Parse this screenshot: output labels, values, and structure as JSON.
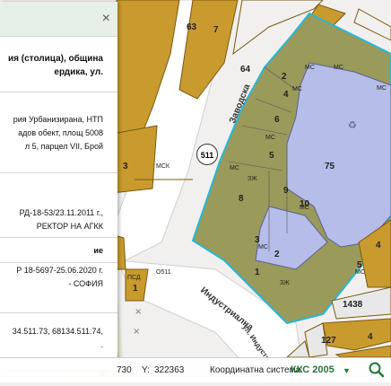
{
  "map": {
    "street_labels": [
      "Заводска",
      "Индустриална",
      "ул. Индустр"
    ],
    "parcel_numbers": [
      "63",
      "7",
      "64",
      "2",
      "3",
      "4",
      "6",
      "5",
      "75",
      "8",
      "9",
      "10",
      "3",
      "2",
      "4",
      "1",
      "5",
      "1438",
      "127",
      "4",
      "1",
      "1"
    ],
    "building_tags": [
      "МС",
      "МС",
      "МС",
      "МС",
      "МСК",
      "МС",
      "ЗЖ",
      "МС",
      "МС",
      "ЗЖ",
      "ПСД",
      "О511",
      "МС",
      "МС"
    ],
    "identifier_badge": "511",
    "colors": {
      "parcel_fill": "#c99a2e",
      "parcel_stroke": "#7a5a10",
      "selected_outline": "#29b6d6",
      "building_fill": "#b5bde8",
      "green_overlay": "#a0a060"
    }
  },
  "panel": {
    "close_label": "×",
    "title_lines": [
      "ия (столица), община",
      "ердика, ул."
    ],
    "body_lines": [
      "рия Урбанизирана, НТП",
      "адов обект, площ 5008",
      "л 5, парцел VII, Брой"
    ],
    "order_line": "РД-18-53/23.11.2011 г.,",
    "director_line": "РЕКТОР НА АГКК",
    "section_header": "ие",
    "order2_line": "Р 18-5697-25.06.2020 г.",
    "city_line": "- СОФИЯ",
    "coords_lines": [
      "34.511.73, 68134.511.74,",
      "."
    ]
  },
  "statusbar": {
    "x_value": "730",
    "y_label": "Y:",
    "y_value": "322363",
    "coord_system_label": "Координатна система:",
    "coord_system_value": "ККС 2005",
    "dropdown_icon": "▼",
    "search_icon": "search-icon"
  }
}
